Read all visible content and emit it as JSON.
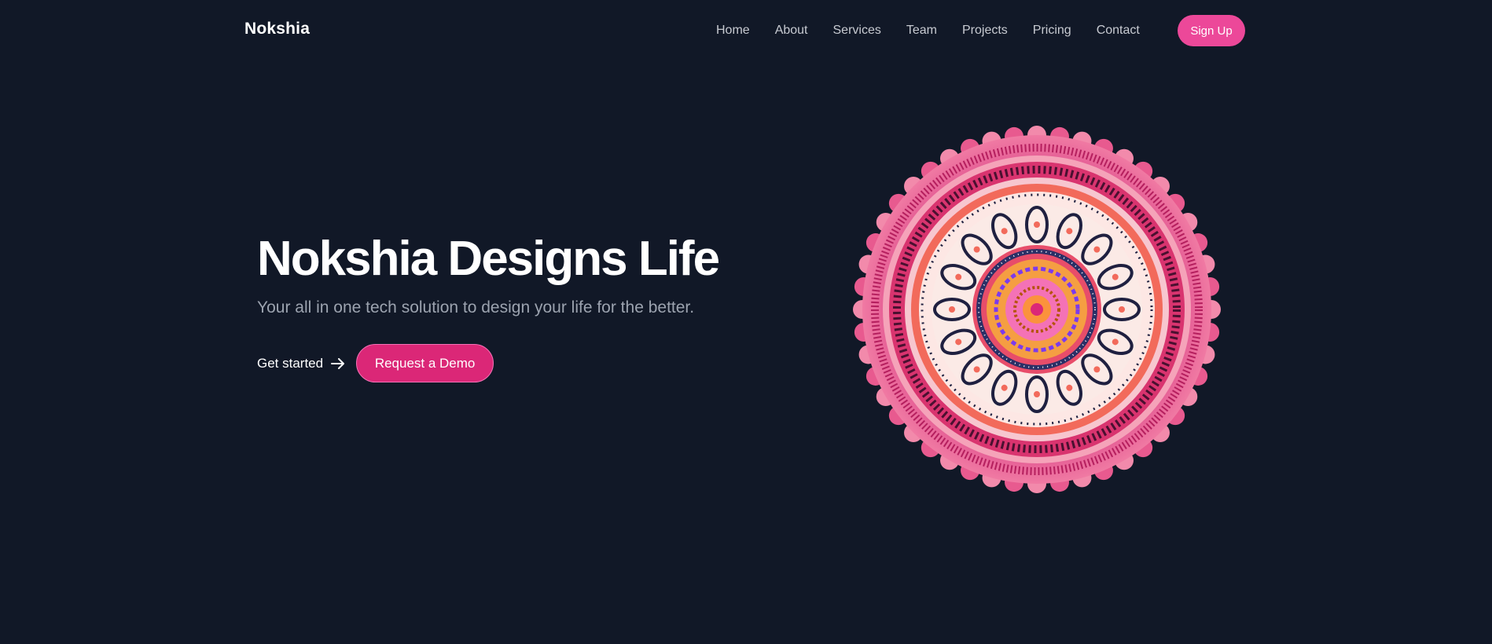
{
  "header": {
    "logo": "Nokshia",
    "nav": [
      "Home",
      "About",
      "Services",
      "Team",
      "Projects",
      "Pricing",
      "Contact"
    ],
    "signup_label": "Sign Up"
  },
  "hero": {
    "title": "Nokshia Designs Life",
    "subtitle": "Your all in one tech solution to design your life for the better.",
    "get_started_label": "Get started",
    "demo_label": "Request a Demo"
  },
  "colors": {
    "background": "#111827",
    "accent": "#ec4899",
    "accent_dark": "#db2777"
  },
  "icons": {
    "arrow": "arrow-right-icon",
    "illustration": "mandala-illustration"
  }
}
